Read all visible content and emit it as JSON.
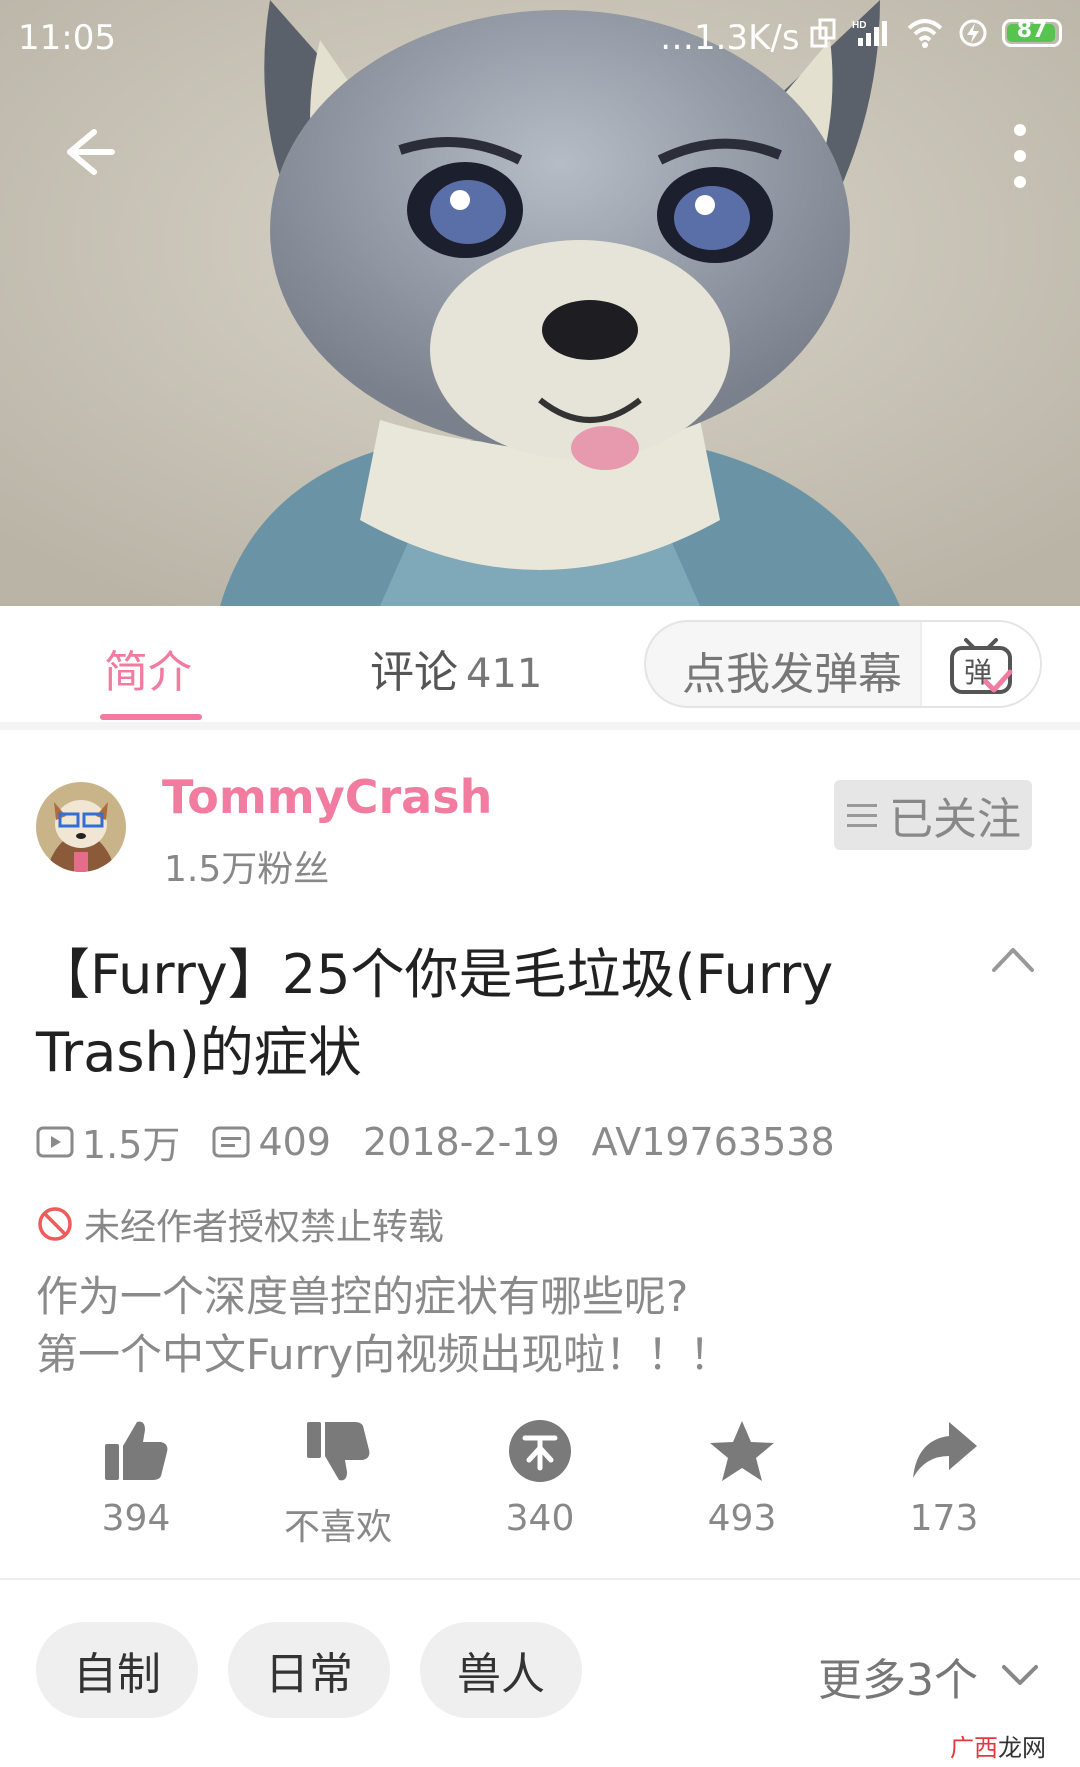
{
  "status_bar": {
    "time": "11:05",
    "network_speed": "…1.3K/s",
    "battery": "87",
    "icons": [
      "rotate-icon",
      "hd-signal-icon",
      "wifi-icon",
      "charging-icon",
      "battery-icon"
    ]
  },
  "video": {
    "back_icon": "arrow-left-icon",
    "more_icon": "more-vertical-icon"
  },
  "tabs": {
    "intro": "简介",
    "comments": "评论",
    "comments_count": "411",
    "danmaku_placeholder": "点我发弹幕",
    "danmaku_icon_text": "弹"
  },
  "uploader": {
    "name": "TommyCrash",
    "fans": "1.5万粉丝",
    "follow_label": "已关注"
  },
  "video_info": {
    "title": "【Furry】25个你是毛垃圾(Furry Trash)的症状",
    "views": "1.5万",
    "danmaku_count": "409",
    "date": "2018-2-19",
    "av_id": "AV19763538",
    "copyright_notice": "未经作者授权禁止转载",
    "description_line1": "作为一个深度兽控的症状有哪些呢?",
    "description_line2": "第一个中文Furry向视频出现啦！！！"
  },
  "actions": {
    "like": "394",
    "dislike": "不喜欢",
    "coin": "340",
    "favorite": "493",
    "share": "173"
  },
  "tags": {
    "items": [
      "自制",
      "日常",
      "兽人"
    ],
    "more": "更多3个"
  },
  "watermark": {
    "red_part": "广西",
    "dark_part": "龙网"
  },
  "colors": {
    "accent": "#f27ba0",
    "icon_gray": "#7a7a7a",
    "battery_green": "#56c44f"
  }
}
